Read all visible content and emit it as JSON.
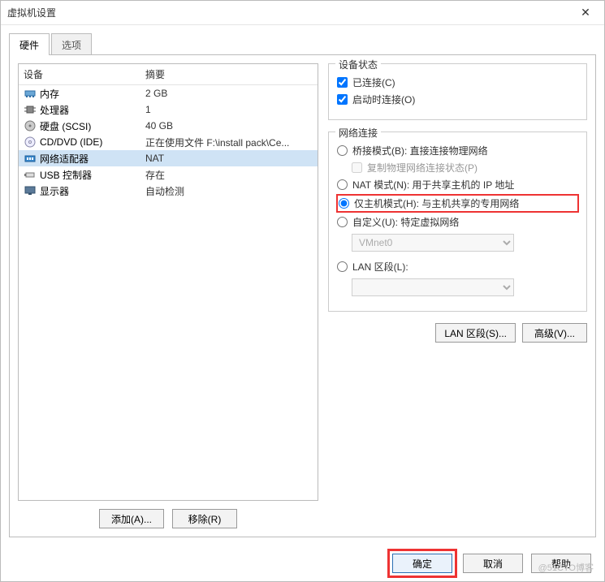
{
  "window": {
    "title": "虚拟机设置"
  },
  "tabs": [
    {
      "label": "硬件"
    },
    {
      "label": "选项"
    }
  ],
  "deviceList": {
    "headers": {
      "device": "设备",
      "summary": "摘要"
    },
    "items": [
      {
        "name": "内存",
        "summary": "2 GB"
      },
      {
        "name": "处理器",
        "summary": "1"
      },
      {
        "name": "硬盘 (SCSI)",
        "summary": "40 GB"
      },
      {
        "name": "CD/DVD (IDE)",
        "summary": "正在使用文件 F:\\install pack\\Ce..."
      },
      {
        "name": "网络适配器",
        "summary": "NAT"
      },
      {
        "name": "USB 控制器",
        "summary": "存在"
      },
      {
        "name": "显示器",
        "summary": "自动检测"
      }
    ]
  },
  "right": {
    "status": {
      "title": "设备状态",
      "connected": "已连接(C)",
      "connectOnStart": "启动时连接(O)"
    },
    "network": {
      "title": "网络连接",
      "bridged": "桥接模式(B): 直接连接物理网络",
      "replicate": "复制物理网络连接状态(P)",
      "nat": "NAT 模式(N): 用于共享主机的 IP 地址",
      "hostOnly": "仅主机模式(H): 与主机共享的专用网络",
      "custom": "自定义(U): 特定虚拟网络",
      "customValue": "VMnet0",
      "lanSegment": "LAN 区段(L):"
    }
  },
  "buttons": {
    "add": "添加(A)...",
    "remove": "移除(R)",
    "lanSegments": "LAN 区段(S)...",
    "advanced": "高级(V)...",
    "ok": "确定",
    "cancel": "取消",
    "help": "帮助"
  },
  "watermark": "@51CTO博客"
}
